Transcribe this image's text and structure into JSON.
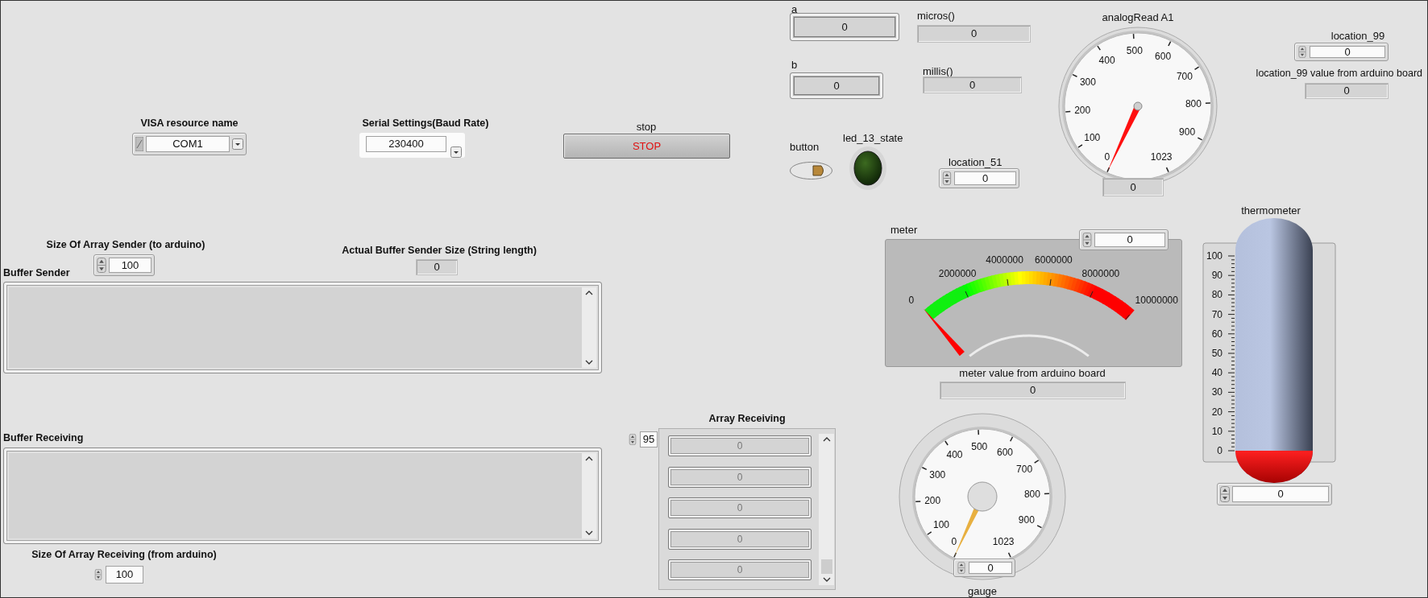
{
  "visa_resource": {
    "label": "VISA resource name",
    "value": "COM1"
  },
  "serial_settings": {
    "label": "Serial Settings(Baud Rate)",
    "value": "230400"
  },
  "stop": {
    "label": "stop",
    "text": "STOP"
  },
  "array_sender_size": {
    "label": "Size Of Array Sender (to arduino)",
    "value": "100"
  },
  "buffer_sender_size": {
    "label": "Actual Buffer Sender Size (String length)",
    "value": "0"
  },
  "buffer_sender": {
    "label": "Buffer Sender"
  },
  "buffer_receiving": {
    "label": "Buffer Receiving"
  },
  "array_receiving_size": {
    "label": "Size Of Array Receiving (from arduino)",
    "value": "100"
  },
  "array_receiving": {
    "label": "Array Receiving",
    "index": "95",
    "elements": [
      "0",
      "0",
      "0",
      "0",
      "0"
    ]
  },
  "a": {
    "label": "a",
    "value": "0"
  },
  "micros": {
    "label": "micros()",
    "value": "0"
  },
  "b": {
    "label": "b",
    "value": "0"
  },
  "millis": {
    "label": "millis()",
    "value": "0"
  },
  "button": {
    "label": "button",
    "on": false
  },
  "led": {
    "label": "led_13_state",
    "on": false
  },
  "location_51": {
    "label": "location_51",
    "value": "0"
  },
  "analog_read": {
    "label": "analogRead A1",
    "scale": [
      "0",
      "100",
      "200",
      "300",
      "400",
      "500",
      "600",
      "700",
      "800",
      "900",
      "1023"
    ],
    "value": "0"
  },
  "location_99": {
    "label": "location_99",
    "value": "0"
  },
  "location_99_value": {
    "label": "location_99 value from arduino board",
    "value": "0"
  },
  "meter": {
    "label": "meter",
    "scale": [
      "0",
      "2000000",
      "4000000",
      "6000000",
      "8000000",
      "10000000"
    ],
    "value": "0"
  },
  "meter_value": {
    "label": "meter value from arduino board",
    "value": "0"
  },
  "thermometer": {
    "label": "thermometer",
    "scale": [
      "100",
      "90",
      "80",
      "70",
      "60",
      "50",
      "40",
      "30",
      "20",
      "10",
      "0"
    ],
    "level": 0,
    "value": "0"
  },
  "gauge": {
    "label": "gauge",
    "scale": [
      "0",
      "100",
      "200",
      "300",
      "400",
      "500",
      "600",
      "700",
      "800",
      "900",
      "1023"
    ],
    "value": "0"
  }
}
